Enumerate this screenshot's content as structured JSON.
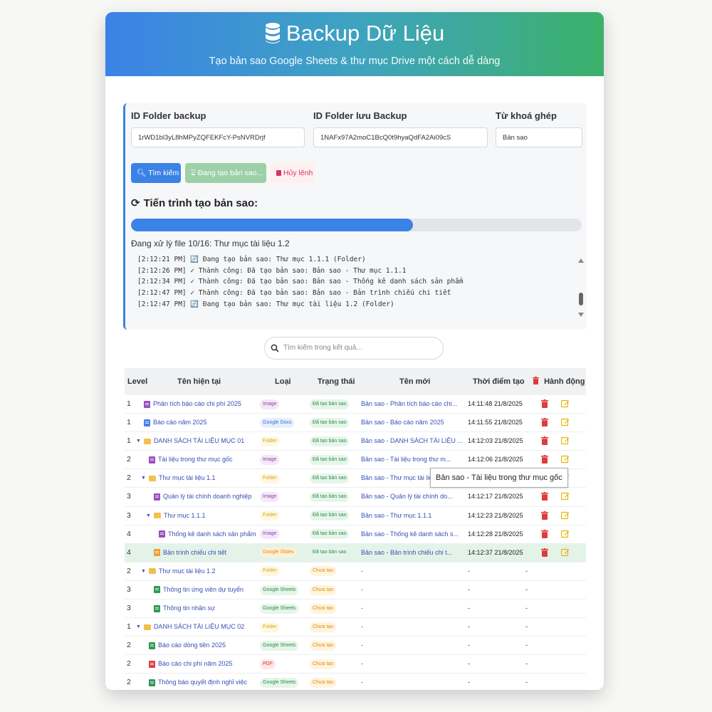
{
  "header": {
    "title": "Backup Dữ Liệu",
    "subtitle": "Tạo bản sao Google Sheets & thư mục Drive một cách dễ dàng",
    "colors": {
      "gradient_start": "#3b82e6",
      "gradient_end": "#3cb16a"
    }
  },
  "form": {
    "folder_backup_label": "ID Folder backup",
    "folder_backup_value": "1rWD1bl3yL8hMPyZQFEKFcY-PsNVRDrjf",
    "folder_save_label": "ID Folder lưu Backup",
    "folder_save_value": "1NAFx97A2moC1BcQ0t9hyaQdFA2Ai09cS",
    "keyword_label": "Từ khoá ghép",
    "keyword_value": "Bản sao"
  },
  "buttons": {
    "search": "Tìm kiếm",
    "creating": "Đang tạo bản sao...",
    "cancel": "Hủy lệnh"
  },
  "progress": {
    "title": "Tiến trình tạo bản sao:",
    "percent": 62.5,
    "status_text": "Đang xử lý file 10/16: Thư mục tài liệu 1.2",
    "logs": [
      "[2:12:21 PM] 🔄 Đang tạo bản sao: Thư mục 1.1.1 (Folder)",
      "[2:12:26 PM] ✓ Thành công: Đã tạo bản sao: Bản sao - Thư mục 1.1.1",
      "[2:12:34 PM] ✓ Thành công: Đã tạo bản sao: Bản sao - Thống kê danh sách sản phẩm",
      "[2:12:47 PM] ✓ Thành công: Đã tạo bản sao: Bản sao - Bản trình chiếu chi tiết",
      "[2:12:47 PM] 🔄 Đang tạo bản sao: Thư mục tài liệu 1.2 (Folder)"
    ]
  },
  "results_search": {
    "placeholder": "Tìm kiếm trong kết quả..."
  },
  "table": {
    "headers": {
      "level": "Level",
      "current_name": "Tên hiện tại",
      "type": "Loại",
      "status": "Trạng thái",
      "new_name": "Tên mới",
      "created_at": "Thời điểm tạo",
      "actions": "Hành động"
    },
    "rows": [
      {
        "level": "1",
        "indent": 0,
        "toggle": "",
        "icon": "image",
        "name": "Phân tích báo cáo chi phí 2025",
        "type": "Image",
        "type_class": "image",
        "status": "Đã tạo bản sao",
        "status_class": "done",
        "new_name": "Bản sao - Phân tích báo cáo chi...",
        "time": "14:11:48 21/8/2025",
        "actions": true
      },
      {
        "level": "1",
        "indent": 0,
        "toggle": "",
        "icon": "docs",
        "name": "Báo cáo năm 2025",
        "type": "Google Docs",
        "type_class": "docs",
        "status": "Đã tạo bản sao",
        "status_class": "done",
        "new_name": "Bản sao - Báo cáo năm 2025",
        "time": "14:11:55 21/8/2025",
        "actions": true
      },
      {
        "level": "1",
        "indent": 0,
        "toggle": "▼",
        "icon": "folder",
        "name": "DANH SÁCH TÀI LIỆU MỤC 01",
        "type": "Folder",
        "type_class": "folder",
        "status": "Đã tạo bản sao",
        "status_class": "done",
        "new_name": "Bản sao - DANH SÁCH TÀI LIỆU ...",
        "time": "14:12:03 21/8/2025",
        "actions": true
      },
      {
        "level": "2",
        "indent": 1,
        "toggle": "",
        "icon": "image",
        "name": "Tài liệu trong thư mục gốc",
        "type": "Image",
        "type_class": "image",
        "status": "Đã tạo bản sao",
        "status_class": "done",
        "new_name": "Bản sao - Tài liệu trong thư m...",
        "time": "14:12:06 21/8/2025",
        "actions": true
      },
      {
        "level": "2",
        "indent": 1,
        "toggle": "▼",
        "icon": "folder",
        "name": "Thư mục tài liệu 1.1",
        "type": "Folder",
        "type_class": "folder",
        "status": "Đã tạo bản sao",
        "status_class": "done",
        "new_name": "Bản sao - Thư mục tài liệu 1.1",
        "time": "",
        "actions": true
      },
      {
        "level": "3",
        "indent": 2,
        "toggle": "",
        "icon": "image",
        "name": "Quản lý tài chính doanh nghiệp",
        "type": "Image",
        "type_class": "image",
        "status": "Đã tạo bản sao",
        "status_class": "done",
        "new_name": "Bản sao - Quản lý tài chính do...",
        "time": "14:12:17 21/8/2025",
        "actions": true
      },
      {
        "level": "3",
        "indent": 2,
        "toggle": "▼",
        "icon": "folder",
        "name": "Thư mục 1.1.1",
        "type": "Folder",
        "type_class": "folder",
        "status": "Đã tạo bản sao",
        "status_class": "done",
        "new_name": "Bản sao - Thư mục 1.1.1",
        "time": "14:12:23 21/8/2025",
        "actions": true
      },
      {
        "level": "4",
        "indent": 3,
        "toggle": "",
        "icon": "image",
        "name": "Thống kê danh sách sản phẩm",
        "type": "Image",
        "type_class": "image",
        "status": "Đã tạo bản sao",
        "status_class": "done",
        "new_name": "Bản sao - Thống kê danh sách s...",
        "time": "14:12:28 21/8/2025",
        "actions": true
      },
      {
        "level": "4",
        "indent": 2,
        "toggle": "",
        "icon": "slides",
        "name": "Bản trình chiếu chi tiết",
        "type": "Google Slides",
        "type_class": "slides",
        "status": "Đã tạo bản sao",
        "status_class": "done",
        "new_name": "Bản sao - Bản trình chiếu chi t...",
        "time": "14:12:37 21/8/2025",
        "actions": true,
        "highlight": true
      },
      {
        "level": "2",
        "indent": 1,
        "toggle": "▼",
        "icon": "folder",
        "name": "Thư mục tài liệu 1.2",
        "type": "Folder",
        "type_class": "folder",
        "status": "Chưa tạo",
        "status_class": "pending",
        "new_name": "-",
        "time": "-",
        "time2": "-",
        "actions": false
      },
      {
        "level": "3",
        "indent": 2,
        "toggle": "",
        "icon": "sheets",
        "name": "Thông tin ứng viên dự tuyển",
        "type": "Google Sheets",
        "type_class": "sheets",
        "status": "Chưa tạo",
        "status_class": "pending",
        "new_name": "-",
        "time": "-",
        "time2": "-",
        "actions": false
      },
      {
        "level": "3",
        "indent": 2,
        "toggle": "",
        "icon": "sheets",
        "name": "Thông tin nhân sự",
        "type": "Google Sheets",
        "type_class": "sheets",
        "status": "Chưa tạo",
        "status_class": "pending",
        "new_name": "-",
        "time": "-",
        "time2": "-",
        "actions": false
      },
      {
        "level": "1",
        "indent": 0,
        "toggle": "▼",
        "icon": "folder",
        "name": "DANH SÁCH TÀI LIỆU MỤC 02",
        "type": "Folder",
        "type_class": "folder",
        "status": "Chưa tạo",
        "status_class": "pending",
        "new_name": "-",
        "time": "-",
        "time2": "-",
        "actions": false
      },
      {
        "level": "2",
        "indent": 1,
        "toggle": "",
        "icon": "sheets",
        "name": "Báo cáo dòng tiền 2025",
        "type": "Google Sheets",
        "type_class": "sheets",
        "status": "Chưa tạo",
        "status_class": "pending",
        "new_name": "-",
        "time": "-",
        "time2": "-",
        "actions": false
      },
      {
        "level": "2",
        "indent": 1,
        "toggle": "",
        "icon": "pdf",
        "name": "Báo cáo chi phí năm 2025",
        "type": "PDF",
        "type_class": "pdf",
        "status": "Chưa tạo",
        "status_class": "pending",
        "new_name": "-",
        "time": "-",
        "time2": "-",
        "actions": false
      },
      {
        "level": "2",
        "indent": 1,
        "toggle": "",
        "icon": "sheets",
        "name": "Thông báo quyết định nghỉ việc",
        "type": "Google Sheets",
        "type_class": "sheets",
        "status": "Chưa tạo",
        "status_class": "pending",
        "new_name": "-",
        "time": "-",
        "time2": "-",
        "actions": false
      }
    ]
  },
  "tooltip": {
    "text": "Bản sao - Tài liệu trong thư mục gốc"
  }
}
